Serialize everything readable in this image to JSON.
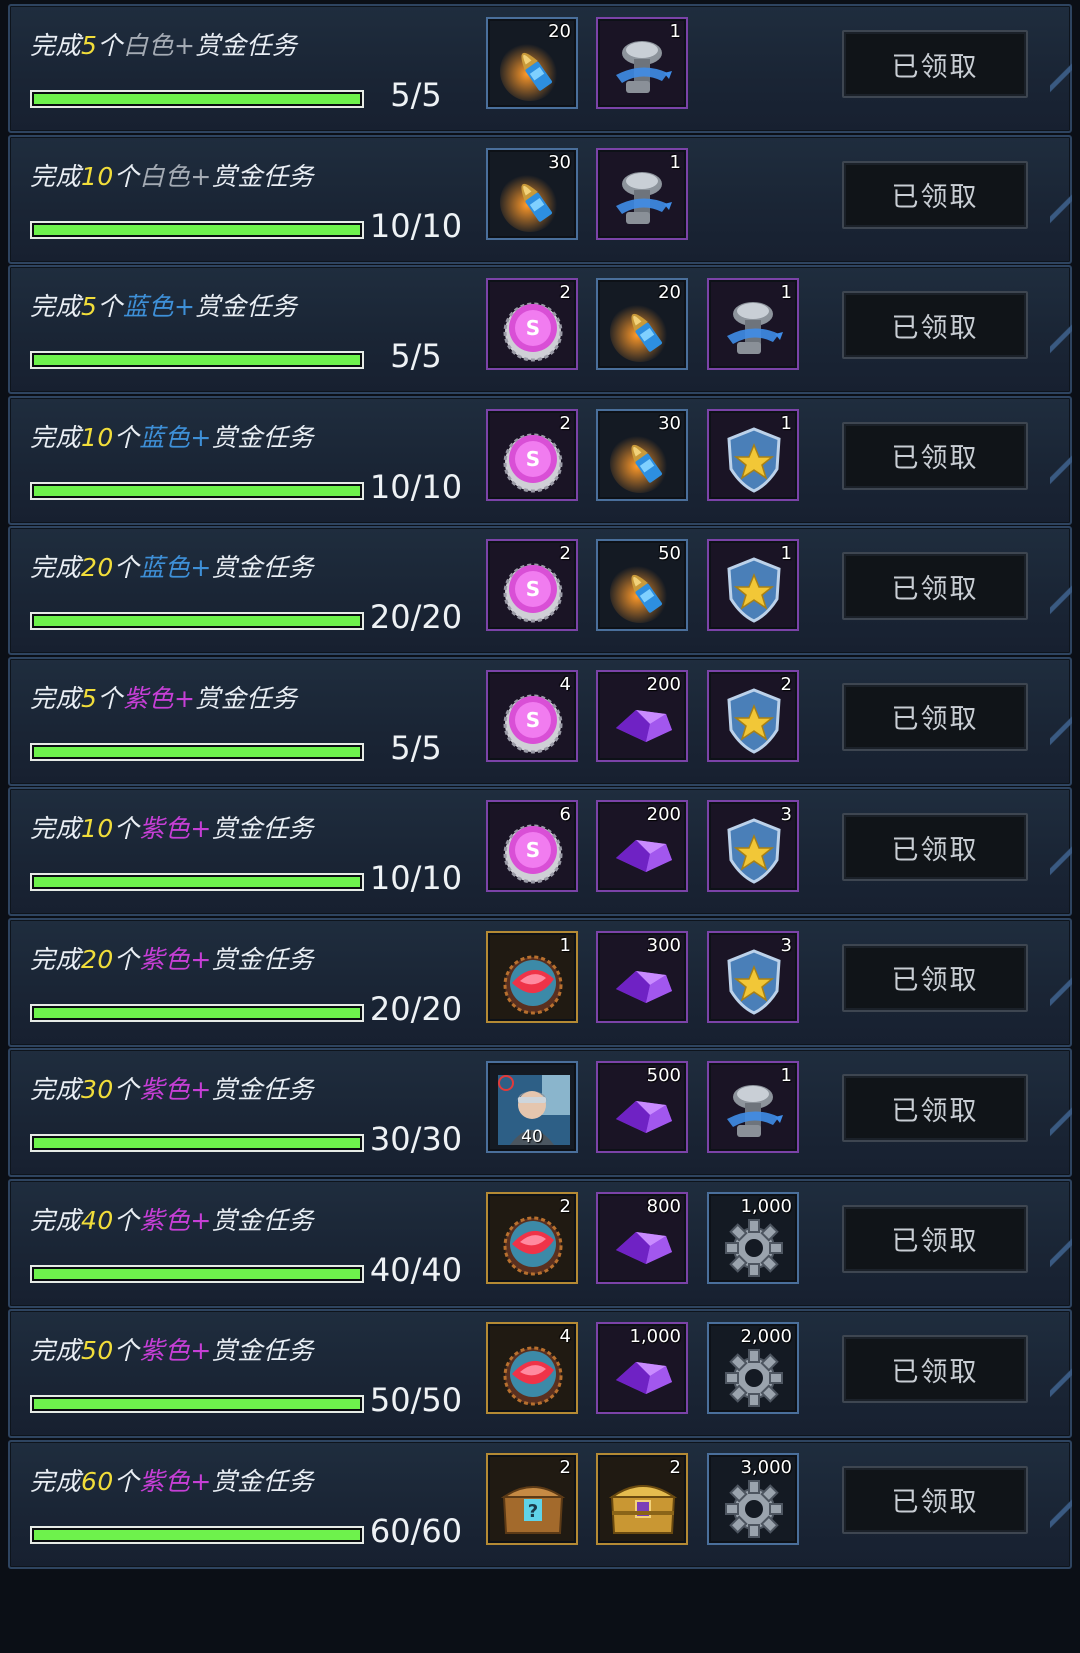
{
  "colors": {
    "progress": "#6ef24c",
    "number": "#f1dd3a",
    "white_quality": "#a4abb4",
    "blue_quality": "#3e90d8",
    "purple_quality": "#c63fd6"
  },
  "tasks": [
    {
      "prefix": "完成",
      "num": "5",
      "unit": "个",
      "quality": "白色",
      "quality_class": "white",
      "plus": "+",
      "suffix": "赏金任务",
      "progress_text": "5/5",
      "progress": 1.0,
      "rewards": [
        {
          "icon": "bullet-icon",
          "count": "20",
          "frame": "blue"
        },
        {
          "icon": "lab-flask-icon",
          "count": "1",
          "frame": "purple"
        }
      ],
      "button": "已领取"
    },
    {
      "prefix": "完成",
      "num": "10",
      "unit": "个",
      "quality": "白色",
      "quality_class": "white",
      "plus": "+",
      "suffix": "赏金任务",
      "progress_text": "10/10",
      "progress": 1.0,
      "rewards": [
        {
          "icon": "bullet-icon",
          "count": "30",
          "frame": "blue"
        },
        {
          "icon": "lab-flask-icon",
          "count": "1",
          "frame": "purple"
        }
      ],
      "button": "已领取"
    },
    {
      "prefix": "完成",
      "num": "5",
      "unit": "个",
      "quality": "蓝色",
      "quality_class": "blue",
      "plus": "+",
      "suffix": "赏金任务",
      "progress_text": "5/5",
      "progress": 1.0,
      "rewards": [
        {
          "icon": "bottle-cap-icon",
          "count": "2",
          "frame": "purple"
        },
        {
          "icon": "bullet-icon",
          "count": "20",
          "frame": "blue"
        },
        {
          "icon": "lab-flask-icon",
          "count": "1",
          "frame": "purple"
        }
      ],
      "button": "已领取"
    },
    {
      "prefix": "完成",
      "num": "10",
      "unit": "个",
      "quality": "蓝色",
      "quality_class": "blue",
      "plus": "+",
      "suffix": "赏金任务",
      "progress_text": "10/10",
      "progress": 1.0,
      "rewards": [
        {
          "icon": "bottle-cap-icon",
          "count": "2",
          "frame": "purple"
        },
        {
          "icon": "bullet-icon",
          "count": "30",
          "frame": "blue"
        },
        {
          "icon": "police-badge-icon",
          "count": "1",
          "frame": "purple"
        }
      ],
      "button": "已领取"
    },
    {
      "prefix": "完成",
      "num": "20",
      "unit": "个",
      "quality": "蓝色",
      "quality_class": "blue",
      "plus": "+",
      "suffix": "赏金任务",
      "progress_text": "20/20",
      "progress": 1.0,
      "rewards": [
        {
          "icon": "bottle-cap-icon",
          "count": "2",
          "frame": "purple"
        },
        {
          "icon": "bullet-icon",
          "count": "50",
          "frame": "blue"
        },
        {
          "icon": "police-badge-icon",
          "count": "1",
          "frame": "purple"
        }
      ],
      "button": "已领取"
    },
    {
      "prefix": "完成",
      "num": "5",
      "unit": "个",
      "quality": "紫色",
      "quality_class": "purple",
      "plus": "+",
      "suffix": "赏金任务",
      "progress_text": "5/5",
      "progress": 1.0,
      "rewards": [
        {
          "icon": "bottle-cap-icon",
          "count": "4",
          "frame": "purple"
        },
        {
          "icon": "purple-crystal-icon",
          "count": "200",
          "frame": "purple"
        },
        {
          "icon": "police-badge-icon",
          "count": "2",
          "frame": "purple"
        }
      ],
      "button": "已领取"
    },
    {
      "prefix": "完成",
      "num": "10",
      "unit": "个",
      "quality": "紫色",
      "quality_class": "purple",
      "plus": "+",
      "suffix": "赏金任务",
      "progress_text": "10/10",
      "progress": 1.0,
      "rewards": [
        {
          "icon": "bottle-cap-icon",
          "count": "6",
          "frame": "purple"
        },
        {
          "icon": "purple-crystal-icon",
          "count": "200",
          "frame": "purple"
        },
        {
          "icon": "police-badge-icon",
          "count": "3",
          "frame": "purple"
        }
      ],
      "button": "已领取"
    },
    {
      "prefix": "完成",
      "num": "20",
      "unit": "个",
      "quality": "紫色",
      "quality_class": "purple",
      "plus": "+",
      "suffix": "赏金任务",
      "progress_text": "20/20",
      "progress": 1.0,
      "rewards": [
        {
          "icon": "red-bottle-cap-icon",
          "count": "1",
          "frame": "gold"
        },
        {
          "icon": "purple-crystal-icon",
          "count": "300",
          "frame": "purple"
        },
        {
          "icon": "police-badge-icon",
          "count": "3",
          "frame": "purple"
        }
      ],
      "button": "已领取"
    },
    {
      "prefix": "完成",
      "num": "30",
      "unit": "个",
      "quality": "紫色",
      "quality_class": "purple",
      "plus": "+",
      "suffix": "赏金任务",
      "progress_text": "30/30",
      "progress": 1.0,
      "rewards": [
        {
          "icon": "hero-portrait-icon",
          "count": "",
          "sub": "40",
          "frame": "blue"
        },
        {
          "icon": "purple-crystal-icon",
          "count": "500",
          "frame": "purple"
        },
        {
          "icon": "lab-flask-icon",
          "count": "1",
          "frame": "purple"
        }
      ],
      "button": "已领取"
    },
    {
      "prefix": "完成",
      "num": "40",
      "unit": "个",
      "quality": "紫色",
      "quality_class": "purple",
      "plus": "+",
      "suffix": "赏金任务",
      "progress_text": "40/40",
      "progress": 1.0,
      "rewards": [
        {
          "icon": "red-bottle-cap-icon",
          "count": "2",
          "frame": "gold"
        },
        {
          "icon": "purple-crystal-icon",
          "count": "800",
          "frame": "purple"
        },
        {
          "icon": "gear-icon",
          "count": "1,000",
          "frame": "blue"
        }
      ],
      "button": "已领取"
    },
    {
      "prefix": "完成",
      "num": "50",
      "unit": "个",
      "quality": "紫色",
      "quality_class": "purple",
      "plus": "+",
      "suffix": "赏金任务",
      "progress_text": "50/50",
      "progress": 1.0,
      "rewards": [
        {
          "icon": "red-bottle-cap-icon",
          "count": "4",
          "frame": "gold"
        },
        {
          "icon": "purple-crystal-icon",
          "count": "1,000",
          "frame": "purple"
        },
        {
          "icon": "gear-icon",
          "count": "2,000",
          "frame": "blue"
        }
      ],
      "button": "已领取"
    },
    {
      "prefix": "完成",
      "num": "60",
      "unit": "个",
      "quality": "紫色",
      "quality_class": "purple",
      "plus": "+",
      "suffix": "赏金任务",
      "progress_text": "60/60",
      "progress": 1.0,
      "rewards": [
        {
          "icon": "mystery-chest-icon",
          "count": "2",
          "frame": "gold"
        },
        {
          "icon": "gold-chest-icon",
          "count": "2",
          "frame": "gold"
        },
        {
          "icon": "gear-icon",
          "count": "3,000",
          "frame": "blue"
        }
      ],
      "button": "已领取"
    }
  ]
}
